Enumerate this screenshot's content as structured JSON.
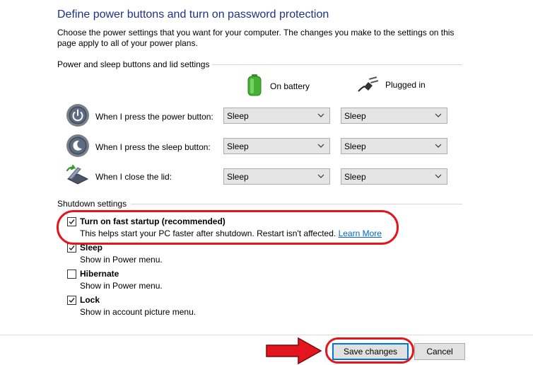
{
  "header": {
    "title": "Define power buttons and turn on password protection",
    "intro": "Choose the power settings that you want for your computer. The changes you make to the settings on this page apply to all of your power plans."
  },
  "power_section": {
    "heading": "Power and sleep buttons and lid settings",
    "columns": {
      "battery": "On battery",
      "plugged": "Plugged in"
    },
    "rows": [
      {
        "label": "When I press the power button:",
        "icon": "power-button-icon",
        "battery": "Sleep",
        "plugged": "Sleep"
      },
      {
        "label": "When I press the sleep button:",
        "icon": "sleep-button-icon",
        "battery": "Sleep",
        "plugged": "Sleep"
      },
      {
        "label": "When I close the lid:",
        "icon": "laptop-lid-icon",
        "battery": "Sleep",
        "plugged": "Sleep"
      }
    ]
  },
  "shutdown_section": {
    "heading": "Shutdown settings",
    "items": [
      {
        "title": "Turn on fast startup (recommended)",
        "desc": "This helps start your PC faster after shutdown. Restart isn't affected.",
        "link": "Learn More",
        "checked": true
      },
      {
        "title": "Sleep",
        "desc": "Show in Power menu.",
        "checked": true
      },
      {
        "title": "Hibernate",
        "desc": "Show in Power menu.",
        "checked": false
      },
      {
        "title": "Lock",
        "desc": "Show in account picture menu.",
        "checked": true
      }
    ]
  },
  "footer": {
    "save_label": "Save changes",
    "cancel_label": "Cancel"
  },
  "colors": {
    "title": "#1e3287",
    "link": "#0066cc",
    "annotation_red": "#e4151c",
    "focus_blue": "#0078d7"
  }
}
